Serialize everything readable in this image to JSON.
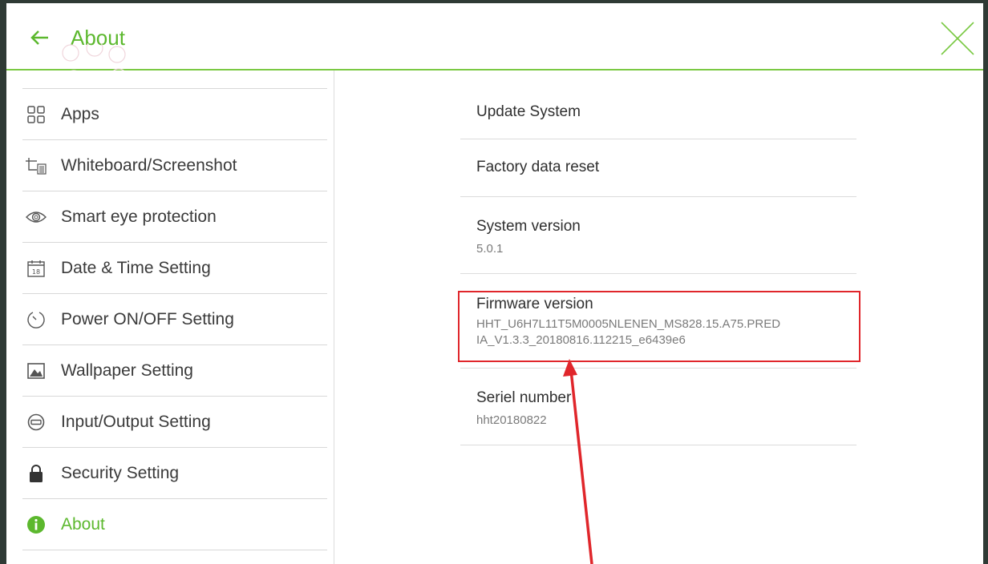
{
  "header": {
    "title": "About",
    "accent_color": "#5cb82e"
  },
  "sidebar": {
    "items": [
      {
        "label": "Apps",
        "icon": "apps-grid-icon"
      },
      {
        "label": "Whiteboard/Screenshot",
        "icon": "whiteboard-icon"
      },
      {
        "label": "Smart eye protection",
        "icon": "eye-icon"
      },
      {
        "label": "Date & Time Setting",
        "icon": "calendar-icon",
        "icon_text": "18"
      },
      {
        "label": "Power ON/OFF Setting",
        "icon": "timer-icon"
      },
      {
        "label": "Wallpaper Setting",
        "icon": "image-icon"
      },
      {
        "label": "Input/Output Setting",
        "icon": "input-output-icon"
      },
      {
        "label": "Security Setting",
        "icon": "lock-icon"
      },
      {
        "label": "About",
        "icon": "info-icon",
        "active": true
      }
    ]
  },
  "settings": {
    "update_system": {
      "title": "Update System"
    },
    "factory_reset": {
      "title": "Factory data reset"
    },
    "system_version": {
      "title": "System version",
      "value": "5.0.1"
    },
    "firmware_version": {
      "title": "Firmware version",
      "value_line1": "HHT_U6H7L11T5M0005NLENEN_MS828.15.A75.PRED",
      "value_line2": "IA_V1.3.3_20180816.112215_e6439e6"
    },
    "serial_number": {
      "title": "Seriel number",
      "value": "hht20180822"
    }
  },
  "annotation": {
    "color": "#e0262b"
  }
}
